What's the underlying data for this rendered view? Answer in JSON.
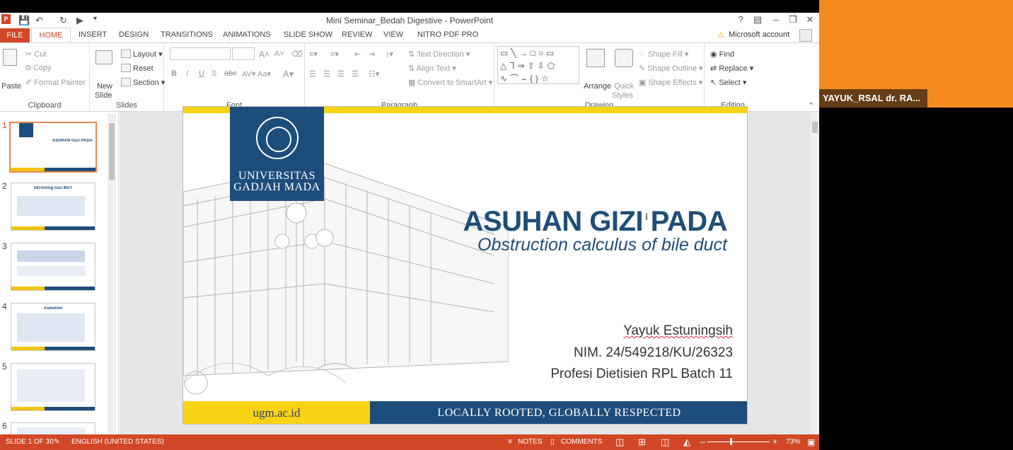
{
  "window": {
    "title": "Mini Seminar_Bedah Digestive - PowerPoint",
    "help": "?",
    "controls": [
      "–",
      "❐",
      "✕"
    ]
  },
  "tabs": [
    "FILE",
    "HOME",
    "INSERT",
    "DESIGN",
    "TRANSITIONS",
    "ANIMATIONS",
    "SLIDE SHOW",
    "REVIEW",
    "VIEW",
    "NITRO PDF PRO"
  ],
  "account": "Microsoft account",
  "ribbon": {
    "clipboard": {
      "paste": "Paste",
      "cut": "Cut",
      "copy": "Copy",
      "format_painter": "Format Painter",
      "label": "Clipboard"
    },
    "slides": {
      "new_slide": "New",
      "new_slide2": "Slide",
      "layout": "Layout",
      "reset": "Reset",
      "section": "Section",
      "label": "Slides"
    },
    "font": {
      "label": "Font"
    },
    "paragraph": {
      "text_direction": "Text Direction",
      "align_text": "Align Text",
      "convert": "Convert to SmartArt",
      "label": "Paragraph"
    },
    "drawing": {
      "arrange": "Arrange",
      "quick_styles": "Quick",
      "quick_styles2": "Styles",
      "shape_fill": "Shape Fill",
      "shape_outline": "Shape Outline",
      "shape_effects": "Shape Effects",
      "label": "Drawing"
    },
    "editing": {
      "find": "Find",
      "replace": "Replace",
      "select": "Select",
      "label": "Editing"
    }
  },
  "thumbnails": [
    {
      "num": "1",
      "title": "ASUHAN GIZI PADA"
    },
    {
      "num": "2",
      "title": "Skrinning Gizi MST"
    },
    {
      "num": "3",
      "title": ""
    },
    {
      "num": "4",
      "title": "Asesmen"
    },
    {
      "num": "5",
      "title": ""
    },
    {
      "num": "6",
      "title": ""
    }
  ],
  "slide": {
    "logo_line1": "UNIVERSITAS",
    "logo_line2": "GADJAH MADA",
    "title": "ASUHAN GIZI PADA",
    "subtitle": "Obstruction calculus of bile duct",
    "author": "Yayuk Estuningsih",
    "nim": "NIM. 24/549218/KU/26323",
    "program": "Profesi Dietisien RPL Batch 11",
    "footer_left": "ugm.ac.id",
    "footer_right": "LOCALLY ROOTED, GLOBALLY RESPECTED"
  },
  "status": {
    "slide_count": "SLIDE 1 OF 30",
    "language": "ENGLISH (UNITED STATES)",
    "notes": "NOTES",
    "comments": "COMMENTS",
    "zoom": "73%"
  },
  "participant": {
    "name": "YAYUK_RSAL dr. RA..."
  },
  "colors": {
    "accent": "#d24726",
    "ugm_blue": "#1d4d7b",
    "ugm_yellow": "#f7d313",
    "video_bg": "#f58b1f"
  }
}
